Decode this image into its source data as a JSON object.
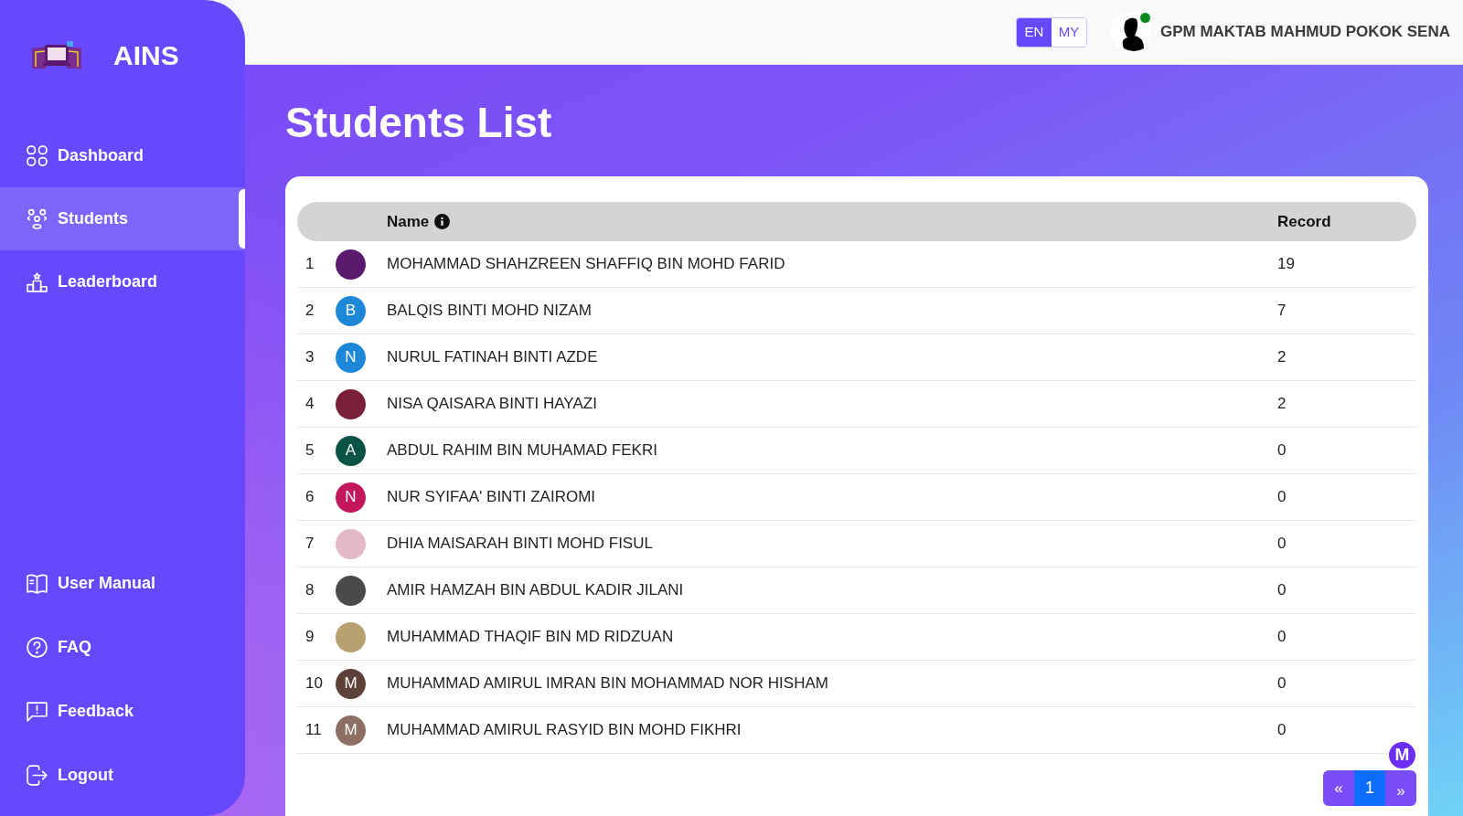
{
  "app": {
    "name": "AINS"
  },
  "sidebar": {
    "items": [
      {
        "label": "Dashboard",
        "selected": false
      },
      {
        "label": "Students",
        "selected": true
      },
      {
        "label": "Leaderboard",
        "selected": false
      }
    ],
    "bottom_items": [
      {
        "label": "User Manual"
      },
      {
        "label": "FAQ"
      },
      {
        "label": "Feedback"
      },
      {
        "label": "Logout"
      }
    ]
  },
  "top_bar": {
    "languages": [
      {
        "label": "EN",
        "selected": true
      },
      {
        "label": "MY",
        "selected": false
      }
    ],
    "user": {
      "name": "GPM MAKTAB MAHMUD POKOK SENA",
      "online": true
    }
  },
  "page_title": "Students List",
  "table": {
    "columns": [
      "Name",
      "Record"
    ],
    "rows": [
      {
        "no": "1",
        "avatar": {
          "kind": "photo",
          "color": "#5b1a6e"
        },
        "name": "MOHAMMAD SHAHZREEN SHAFFIQ BIN MOHD FARID",
        "record": "19"
      },
      {
        "no": "2",
        "avatar": {
          "kind": "letter",
          "letter": "B",
          "color": "#1e88d8"
        },
        "name": "BALQIS BINTI MOHD NIZAM",
        "record": "7"
      },
      {
        "no": "3",
        "avatar": {
          "kind": "letter",
          "letter": "N",
          "color": "#1e88d8"
        },
        "name": "NURUL FATINAH BINTI AZDE",
        "record": "2"
      },
      {
        "no": "4",
        "avatar": {
          "kind": "photo",
          "color": "#7a1f3a"
        },
        "name": "NISA QAISARA BINTI HAYAZI",
        "record": "2"
      },
      {
        "no": "5",
        "avatar": {
          "kind": "letter",
          "letter": "A",
          "color": "#0b5345"
        },
        "name": "ABDUL RAHIM BIN MUHAMAD FEKRI",
        "record": "0"
      },
      {
        "no": "6",
        "avatar": {
          "kind": "letter",
          "letter": "N",
          "color": "#c2185b"
        },
        "name": "NUR SYIFAA' BINTI ZAIROMI",
        "record": "0"
      },
      {
        "no": "7",
        "avatar": {
          "kind": "photo",
          "color": "#e3b8c8"
        },
        "name": "DHIA MAISARAH BINTI MOHD FISUL",
        "record": "0"
      },
      {
        "no": "8",
        "avatar": {
          "kind": "photo",
          "color": "#4a4a4a"
        },
        "name": "AMIR HAMZAH BIN ABDUL KADIR JILANI",
        "record": "0"
      },
      {
        "no": "9",
        "avatar": {
          "kind": "photo",
          "color": "#b8a070"
        },
        "name": "MUHAMMAD THAQIF BIN MD RIDZUAN",
        "record": "0"
      },
      {
        "no": "10",
        "avatar": {
          "kind": "letter",
          "letter": "M",
          "color": "#5d4037"
        },
        "name": "MUHAMMAD AMIRUL IMRAN BIN MOHAMMAD NOR HISHAM",
        "record": "0"
      },
      {
        "no": "11",
        "avatar": {
          "kind": "letter",
          "letter": "M",
          "color": "#8d6e63"
        },
        "name": "MUHAMMAD AMIRUL RASYID BIN MOHD FIKHRI",
        "record": "0"
      }
    ]
  },
  "pagination": {
    "previous": "«",
    "pages": [
      {
        "label": "1",
        "selected": true
      }
    ],
    "next": "»"
  },
  "chat_button": {
    "label": "M"
  }
}
